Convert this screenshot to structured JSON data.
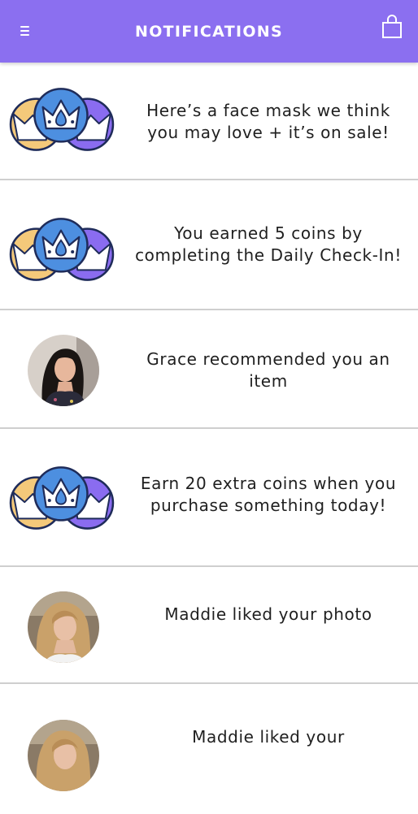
{
  "header": {
    "title": "NOTIFICATIONS",
    "menu_icon": "hamburger-menu-icon",
    "bag_icon": "shopping-bag-icon",
    "bg_color": "#8b6ff0"
  },
  "notifications": [
    {
      "icon": "coins-crown-icon",
      "text": "Here’s a face mask we think you may love + it’s on sale!"
    },
    {
      "icon": "coins-crown-icon",
      "text": "You earned 5 coins by completing the Daily Check-In!"
    },
    {
      "icon": "avatar",
      "text": "Grace recommended you an item"
    },
    {
      "icon": "coins-crown-icon",
      "text": "Earn 20 extra coins when you purchase something today!"
    },
    {
      "icon": "avatar",
      "text": "Maddie liked your photo"
    },
    {
      "icon": "avatar",
      "text": "Maddie liked your"
    }
  ],
  "colors": {
    "coin_yellow": "#f4c97a",
    "coin_purple": "#8a6cf0",
    "coin_blue": "#4d8fe0",
    "coin_outline": "#1f2c5a",
    "divider": "#cfcfcf"
  }
}
